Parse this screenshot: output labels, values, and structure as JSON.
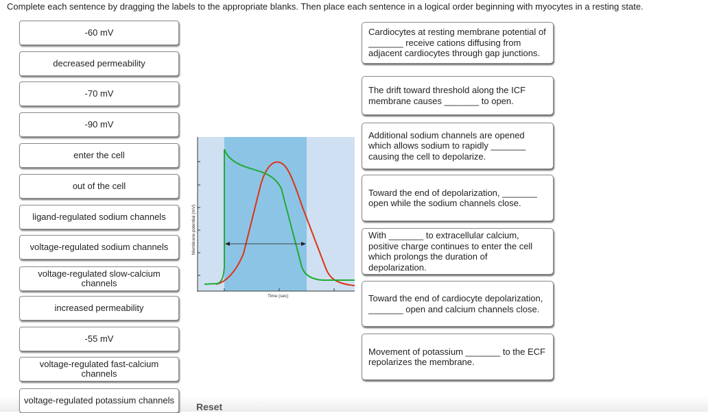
{
  "instructions": "Complete each sentence by dragging the labels to the appropriate blanks. Then place each sentence in a logical order beginning with myocytes in a resting state.",
  "labels": [
    "-60 mV",
    "decreased permeability",
    "-70 mV",
    "-90 mV",
    "enter the cell",
    "out of the cell",
    "ligand-regulated sodium channels",
    "voltage-regulated sodium channels",
    "voltage-regulated slow-calcium channels",
    "increased permeability",
    "-55 mV",
    "voltage-regulated fast-calcium channels",
    "voltage-regulated potassium channels"
  ],
  "sentences": [
    "Cardiocytes at resting membrane potential of _______ receive cations diffusing from adjacent cardiocytes through gap junctions.",
    "The drift toward threshold along the ICF membrane causes _______ to open.",
    "Additional sodium channels are opened which allows sodium to rapidly _______ causing the cell to depolarize.",
    "Toward the end of depolarization, _______ open while the sodium channels close.",
    "With _______ to extracellular calcium, positive charge continues to enter the cell which prolongs the duration of depolarization.",
    "Toward the end of cardiocyte depolarization, _______ open and calcium channels close.",
    "Movement of potassium _______ to the ECF repolarizes the membrane."
  ],
  "figure": {
    "ylabel": "Membrane potential (mV)",
    "xlabel": "Time (sec)",
    "colors": {
      "background": "#cfe0f2",
      "band": "#8cc4e6",
      "green": "#22aa33",
      "red": "#dd3311"
    }
  },
  "reset_label": "Reset"
}
